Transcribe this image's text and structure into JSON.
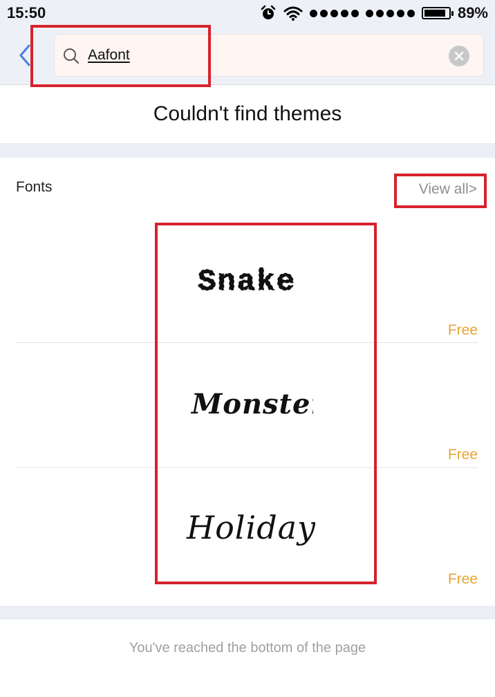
{
  "status_bar": {
    "time": "15:50",
    "battery": "89%",
    "battery_level": 0.89
  },
  "search": {
    "query": "Aafont"
  },
  "results": {
    "no_themes_message": "Couldn't find themes"
  },
  "fonts_section": {
    "title": "Fonts",
    "view_all": "View all>",
    "items": [
      {
        "name": "Snake",
        "price": "Free",
        "preview_style": "pixel-dotted"
      },
      {
        "name": "Monster",
        "price": "Free",
        "preview_style": "monster-bold"
      },
      {
        "name": "Holiday",
        "price": "Free",
        "preview_style": "handwritten"
      }
    ]
  },
  "footer": {
    "end_message": "You've reached the bottom of the page"
  },
  "colors": {
    "accent_back": "#4a7ee0",
    "price": "#e7a437",
    "annotation": "#d6222c",
    "band": "#eceef6"
  }
}
